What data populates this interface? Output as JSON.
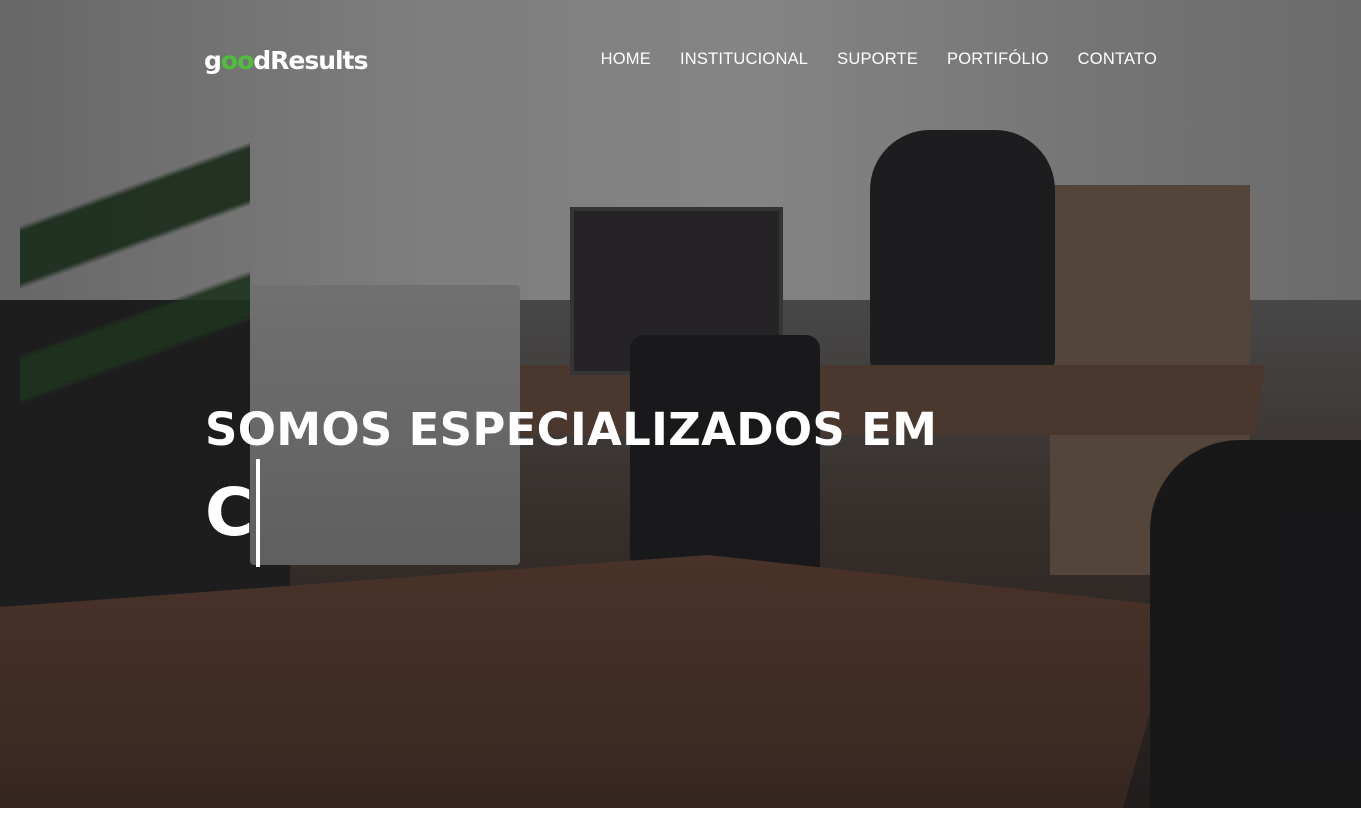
{
  "colors": {
    "accent": "#4fbf3a",
    "text": "#ffffff"
  },
  "header": {
    "logo": {
      "part1": "g",
      "part2": "oo",
      "part3": "dResults"
    },
    "nav": [
      {
        "label": "HOME"
      },
      {
        "label": "INSTITUCIONAL"
      },
      {
        "label": "SUPORTE"
      },
      {
        "label": "PORTIFÓLIO"
      },
      {
        "label": "CONTATO"
      }
    ]
  },
  "hero": {
    "title": "SOMOS ESPECIALIZADOS EM",
    "typed_text": "C"
  }
}
